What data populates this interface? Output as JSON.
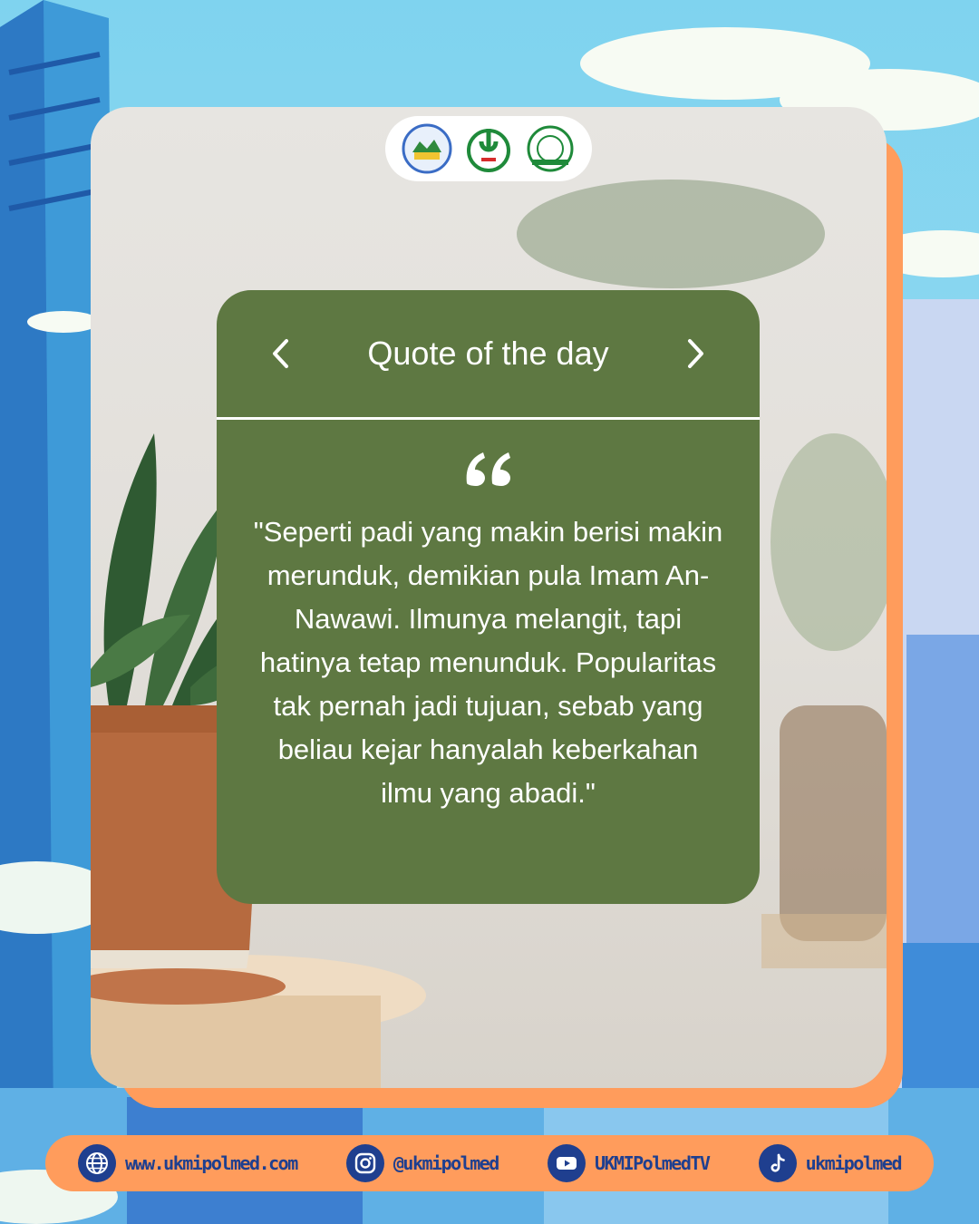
{
  "logos": {
    "items": [
      {
        "name": "institution-logo-1"
      },
      {
        "name": "institution-logo-2"
      },
      {
        "name": "institution-logo-3"
      }
    ]
  },
  "quote": {
    "title": "Quote of the day",
    "text": "\"Seperti padi yang makin berisi makin merunduk, demikian pula Imam An-Nawawi. Ilmunya melangit, tapi hatinya tetap menunduk. Popularitas tak pernah jadi tujuan, sebab yang beliau kejar hanyalah keberkahan ilmu yang abadi.\"",
    "accent_color": "#5e7842"
  },
  "footer": {
    "website": "www.ukmipolmed.com",
    "instagram": "@ukmipolmed",
    "youtube": "UKMIPolmedTV",
    "tiktok": "ukmipolmed",
    "color": "#ff9c5c"
  }
}
